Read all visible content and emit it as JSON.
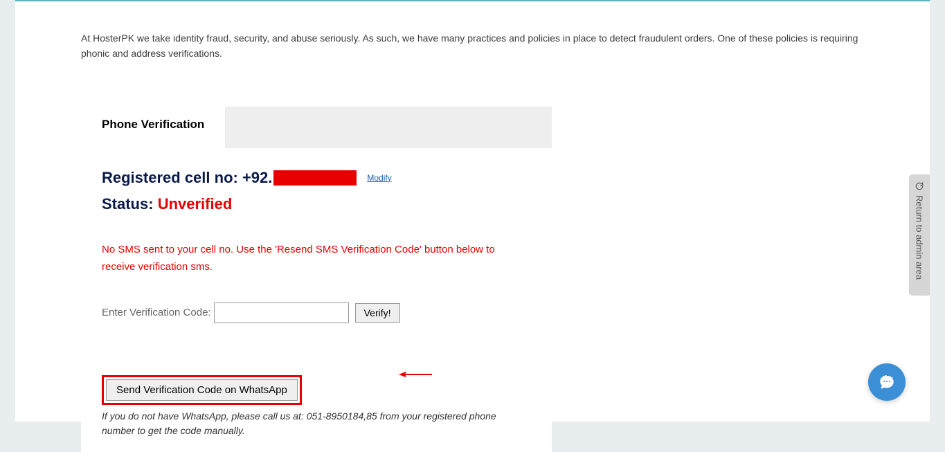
{
  "intro": "At HosterPK we take identity fraud, security, and abuse seriously. As such, we have many practices and policies in place to detect fraudulent orders. One of these policies is requiring phonic and address verifications.",
  "tab": {
    "label": "Phone Verification"
  },
  "cell": {
    "prefix": "Registered cell no: +92.",
    "modify": "Modify"
  },
  "status": {
    "label": "Status: ",
    "value": "Unverified"
  },
  "warning": "No SMS sent to your cell no. Use the 'Resend SMS Verification Code' button below to receive verification sms.",
  "verify": {
    "label": "Enter Verification Code:",
    "button": "Verify!"
  },
  "whatsapp": {
    "button": "Send Verification Code on WhatsApp"
  },
  "note": "If you do not have WhatsApp, please call us at: 051-8950184,85 from your registered phone number to get the code manually.",
  "admin": {
    "label": "Return to admin area"
  }
}
